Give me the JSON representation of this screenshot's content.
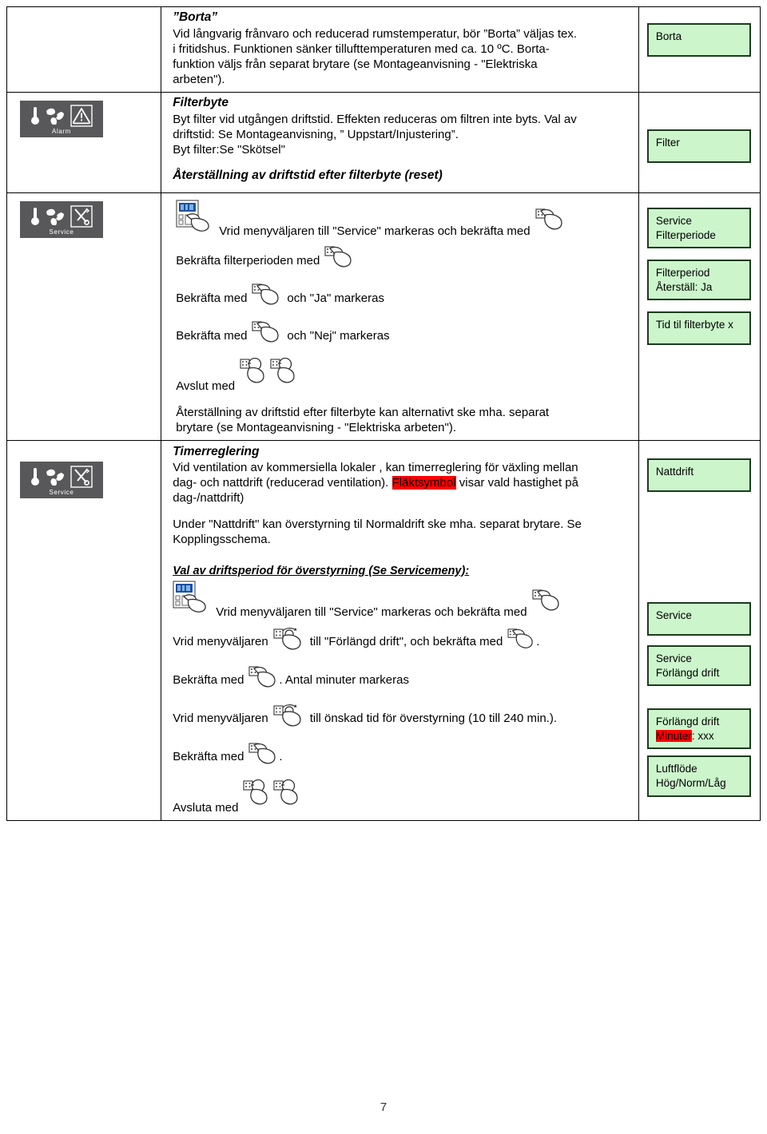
{
  "document": {
    "page_number": "7"
  },
  "sections": {
    "borta": {
      "heading": "”Borta”",
      "body_lines": [
        "Vid långvarig frånvaro och reducerad rumstemperatur, bör ”Borta” väljas tex.",
        "i fritidshus. Funktionen sänker tillufttemperaturen med ca. 10 ºC. Borta-",
        "funktion väljs från separat brytare (se Montageanvisning - \"Elektriska",
        "arbeten\")."
      ]
    },
    "filterbyte": {
      "heading": "Filterbyte",
      "body_lines": [
        "Byt filter vid utgången driftstid. Effekten reduceras om filtren inte byts. Val av",
        "driftstid:  Se Montageanvisning, ” Uppstart/Injustering”.",
        "Byt filter:Se \"Skötsel\""
      ],
      "reset_heading": "Återställning av driftstid efter filterbyte (reset)",
      "steps": [
        {
          "icon": "panel-hand-icon",
          "before": "",
          "after": "Vrid menyväljaren till \"Service\" markeras och bekräfta med",
          "trailing_icon": "hand-press-icon"
        },
        {
          "icon": "hand-press-icon",
          "before": "Bekräfta filterperioden med",
          "after": "",
          "trailing_icon": ""
        },
        {
          "icon": "hand-press-icon",
          "before": "Bekräfta med",
          "after": "och \"Ja\" markeras",
          "trailing_icon": ""
        },
        {
          "icon": "hand-press-icon",
          "before": "Bekräfta med",
          "after": "och \"Nej\" markeras",
          "trailing_icon": ""
        },
        {
          "icon": "hand-press-double-icon",
          "before": "Avslut med",
          "after": "",
          "trailing_icon": ""
        }
      ],
      "note_lines": [
        "Återställning av driftstid efter filterbyte kan alternativt ske mha. separat",
        "brytare (se Montageanvisning - \"Elektriska arbeten\")."
      ]
    },
    "timerreglering": {
      "heading": "Timerreglering",
      "body_before": "Vid ventilation av kommersiella lokaler , kan timerreglering för växling mellan\ndag- och nattdrift (reducerad ventilation). ",
      "highlight_word": "Fläktsymbol",
      "body_after": " visar vald hastighet på\ndag-/nattdrift)",
      "paragraph2_lines": [
        "Under \"Nattdrift\" kan överstyrning til Normaldrift ske mha. separat brytare. Se",
        "Kopplingsschema."
      ],
      "subheading": "Val av driftsperiod för överstyrning (Se Servicemeny):",
      "steps": [
        {
          "icon": "panel-hand-icon",
          "before": "",
          "after": "Vrid menyväljaren till \"Service\" markeras och bekräfta med",
          "trailing_icon": "hand-press-icon"
        },
        {
          "icon": "hand-rotate-icon",
          "before": "Vrid menyväljaren",
          "after": "till \"Förlängd drift\", och bekräfta med",
          "trailing_icon": "hand-press-icon",
          "tail_text": "."
        },
        {
          "icon": "hand-press-icon",
          "before": "Bekräfta med",
          "after": ". Antal minuter markeras",
          "trailing_icon": ""
        },
        {
          "icon": "hand-rotate-icon",
          "before": "Vrid menyväljaren",
          "after": "till önskad tid för överstyrning (10 till 240 min.).",
          "trailing_icon": ""
        },
        {
          "icon": "hand-press-icon",
          "before": "Bekräfta med",
          "after": ".",
          "trailing_icon": ""
        },
        {
          "icon": "hand-press-double-icon",
          "before": "Avsluta med",
          "after": "",
          "trailing_icon": ""
        }
      ]
    }
  },
  "status_icons": [
    {
      "name": "alarm-status-icon",
      "label": "Alarm",
      "symbol": "warning-triangle-icon"
    },
    {
      "name": "service-status-icon",
      "label": "Service",
      "symbol": "tools-icon"
    },
    {
      "name": "service-status-icon-2",
      "label": "Service",
      "symbol": "tools-icon"
    }
  ],
  "displays": {
    "borta": [
      {
        "lines": [
          "Borta"
        ]
      }
    ],
    "filter": [
      {
        "lines": [
          "Filter"
        ]
      }
    ],
    "service_filter": [
      {
        "lines": [
          "Service",
          "Filterperiode"
        ]
      },
      {
        "lines": [
          "Filterperiod",
          "Återställ: Ja"
        ]
      },
      {
        "lines": [
          "Tid til filterbyte x"
        ]
      }
    ],
    "nattdrift": [
      {
        "lines": [
          "Nattdrift"
        ]
      }
    ],
    "service_forlangd": [
      {
        "lines": [
          "Service"
        ]
      },
      {
        "lines": [
          "Service",
          "Förlängd drift"
        ]
      },
      {
        "lines": [
          "Förlängd drift"
        ],
        "highlight_line": {
          "highlight": "Minuter",
          "rest": ":  xxx"
        }
      },
      {
        "lines": [
          "Luftflöde",
          "Hög/Norm/Låg"
        ]
      }
    ]
  },
  "colors": {
    "display_bg": "#ccf5cc",
    "display_border": "#1b3b1b",
    "highlight": "#ff0000",
    "lcd_bg": "#58585a"
  }
}
